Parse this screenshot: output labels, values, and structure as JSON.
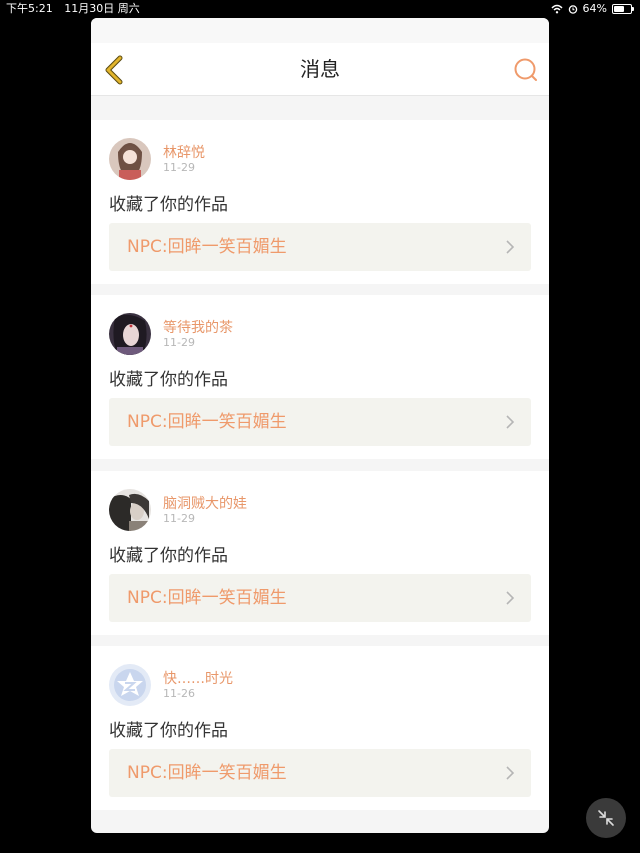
{
  "status": {
    "time": "下午5:21",
    "date": "11月30日 周六",
    "battery": "64%",
    "battery_level": 0.64
  },
  "nav": {
    "title": "消息",
    "back_icon": "chevron-left-icon",
    "search_icon": "search-icon"
  },
  "colors": {
    "accent": "#ef9a6b",
    "name": "#e8976a",
    "back": "#d7a526"
  },
  "messages": [
    {
      "user": "林辞悦",
      "date": "11-29",
      "action": "收藏了你的作品",
      "work": "NPC:回眸一笑百媚生"
    },
    {
      "user": "等待我的茶",
      "date": "11-29",
      "action": "收藏了你的作品",
      "work": "NPC:回眸一笑百媚生"
    },
    {
      "user": "脑洞贼大的娃",
      "date": "11-29",
      "action": "收藏了你的作品",
      "work": "NPC:回眸一笑百媚生"
    },
    {
      "user": "快……时光",
      "date": "11-26",
      "action": "收藏了你的作品",
      "work": "NPC:回眸一笑百媚生"
    }
  ]
}
